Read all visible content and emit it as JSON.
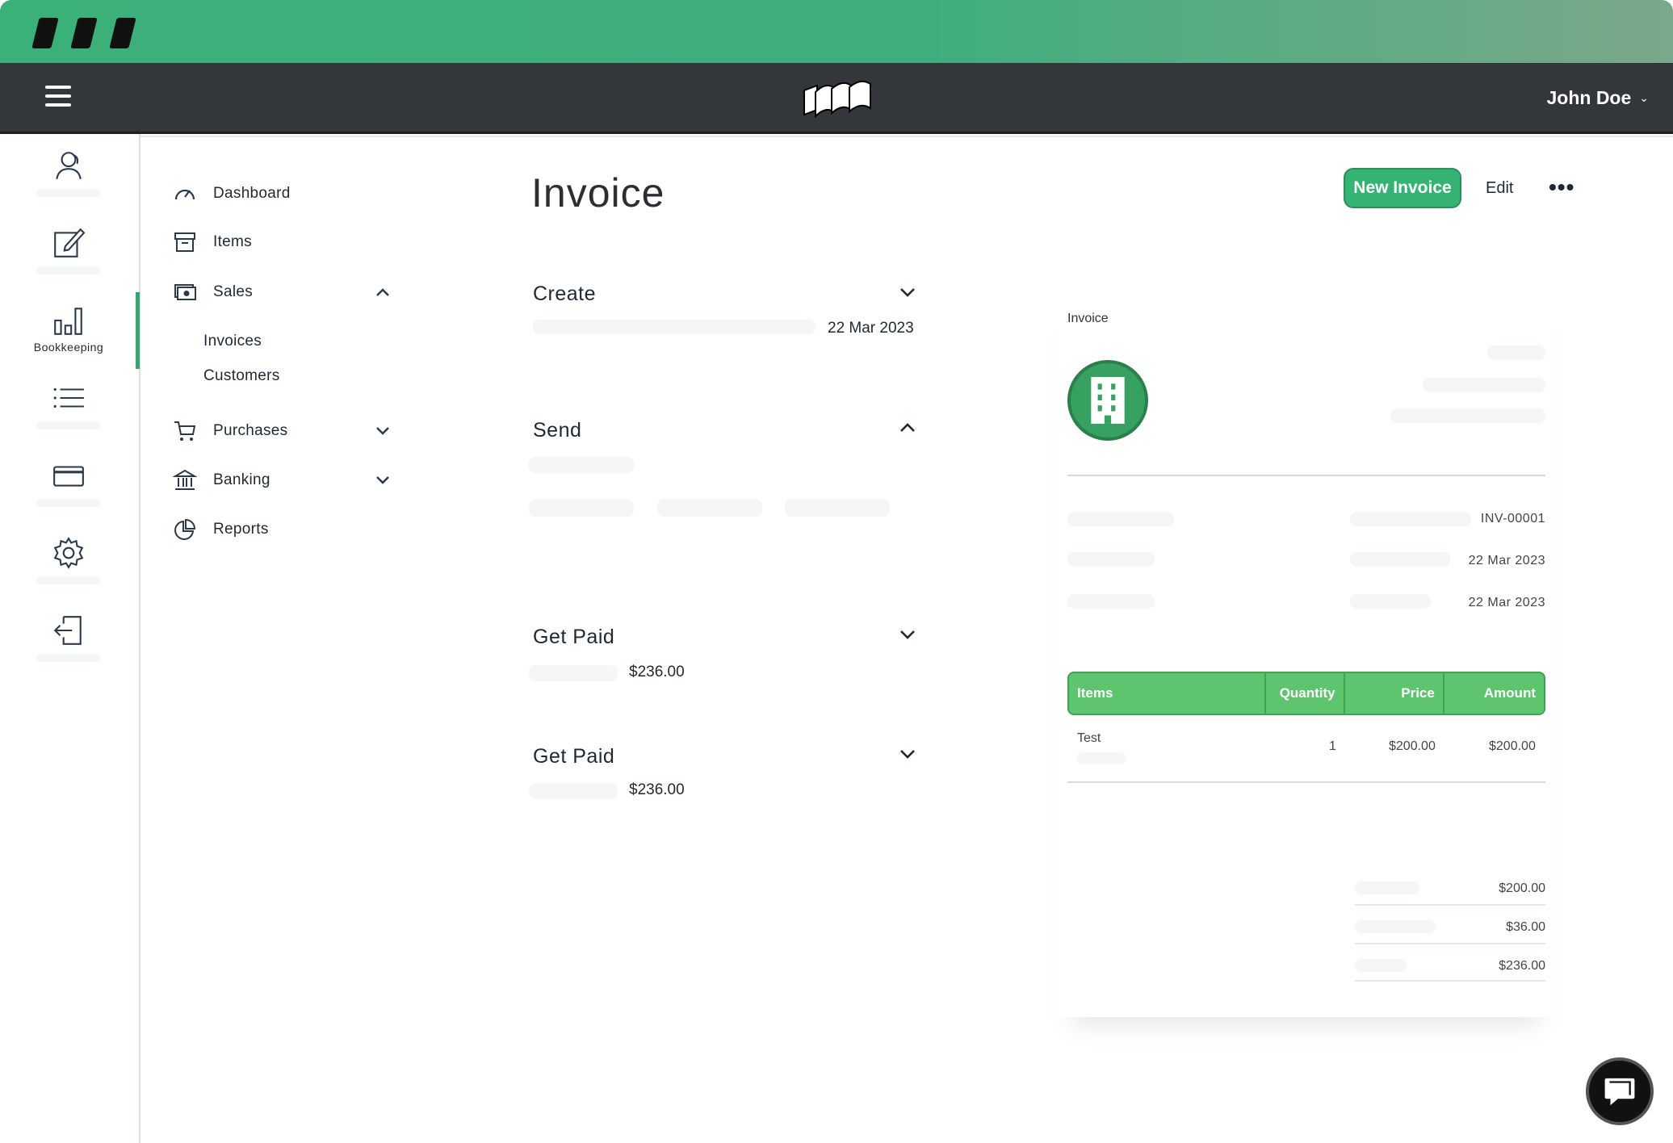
{
  "app": {
    "user_name": "John Doe"
  },
  "rail": [
    {
      "name": "contacts-icon",
      "label": ""
    },
    {
      "name": "edit-icon",
      "label": ""
    },
    {
      "name": "bar-chart-icon",
      "label": "Bookkeeping"
    },
    {
      "name": "list-icon",
      "label": ""
    },
    {
      "name": "card-icon",
      "label": ""
    },
    {
      "name": "gear-icon",
      "label": ""
    },
    {
      "name": "logout-icon",
      "label": ""
    }
  ],
  "nav": {
    "dashboard": "Dashboard",
    "items": "Items",
    "sales": "Sales",
    "invoices": "Invoices",
    "customers": "Customers",
    "purchases": "Purchases",
    "banking": "Banking",
    "reports": "Reports"
  },
  "main": {
    "title": "Invoice",
    "new_invoice": "New Invoice",
    "edit": "Edit",
    "more": "•••",
    "sections": {
      "create": {
        "title": "Create",
        "value": "22 Mar 2023"
      },
      "send": {
        "title": "Send"
      },
      "get_paid_1": {
        "title": "Get Paid",
        "value": "$236.00"
      },
      "get_paid_2": {
        "title": "Get Paid",
        "value": "$236.00"
      }
    }
  },
  "preview": {
    "label": "Invoice",
    "invoice_number": "INV-00001",
    "date_1": "22 Mar 2023",
    "date_2": "22 Mar 2023",
    "table_headers": {
      "items": "Items",
      "quantity": "Quantity",
      "price": "Price",
      "amount": "Amount"
    },
    "row": {
      "item": "Test",
      "quantity": "1",
      "price": "$200.00",
      "amount": "$200.00"
    },
    "totals": {
      "subtotal": "$200.00",
      "tax": "$36.00",
      "total": "$236.00"
    }
  },
  "colors": {
    "accent": "#35b373",
    "topbar": "#33363a",
    "table_header": "#5ec46e"
  }
}
